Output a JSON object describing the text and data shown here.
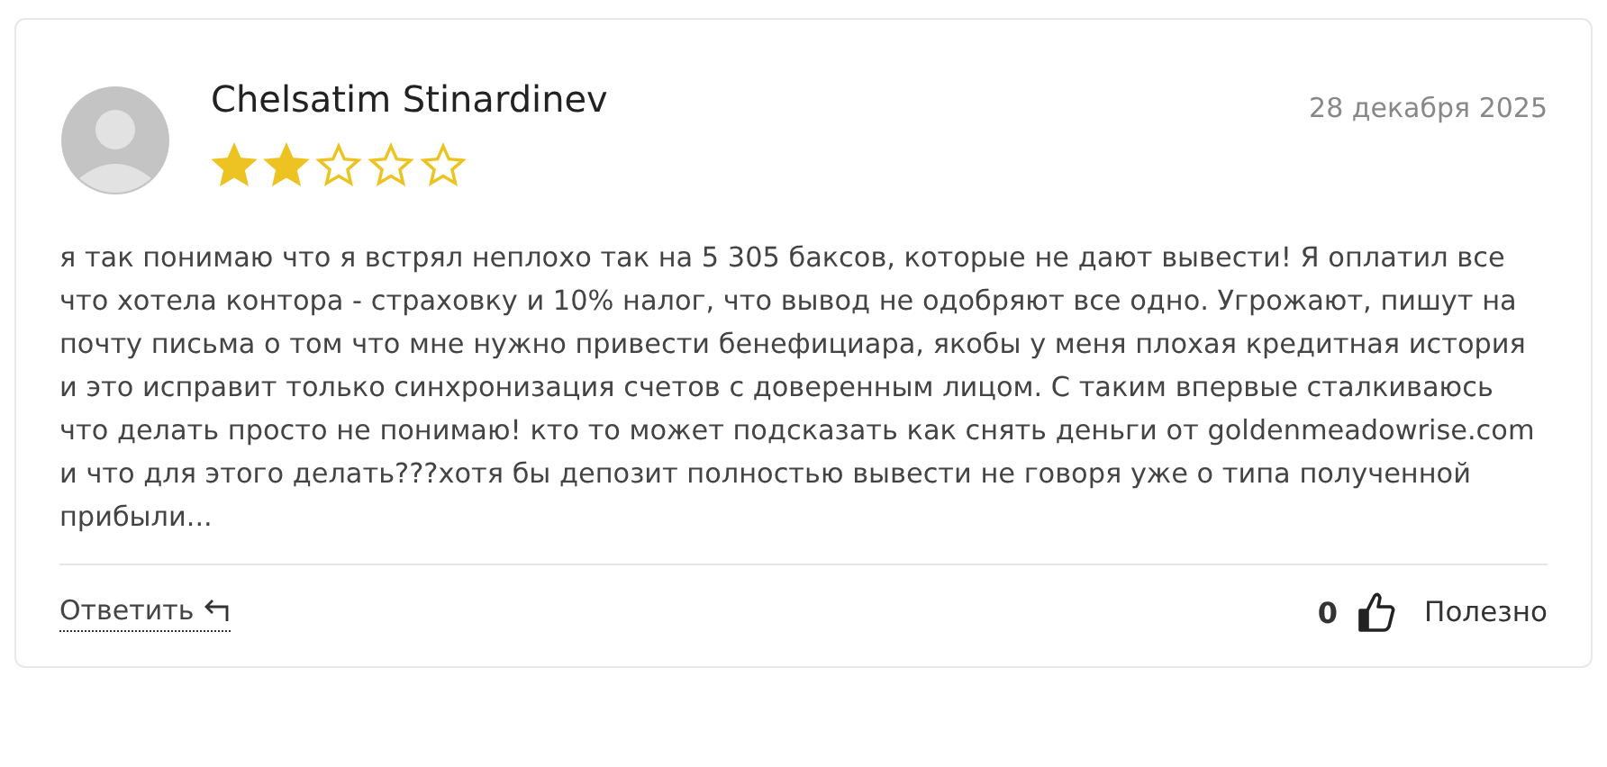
{
  "review": {
    "author": "Chelsatim Stinardinev",
    "date": "28 декабря 2025",
    "stars": 2,
    "text": "я так понимаю что я встрял неплохо так на 5 305 баксов, которые не дают вывести! Я оплатил все что хотела контора - страховку и 10% налог, что вывод не одобряют все одно. Угрожают, пишут на почту письма о том что мне нужно привести бенефициара, якобы у меня плохая кредитная история и это исправит только синхронизация счетов с доверенным лицом. С таким впервые сталкиваюсь что делать просто не понимаю! кто то может подсказать как снять деньги от goldenmeadowrise.com и что для этого делать???хотя бы депозит полностью вывести не говоря уже о типа полученной прибыли..."
  },
  "footer": {
    "reply_label": "Ответить",
    "likes": "0",
    "helpful_label": "Полезно"
  }
}
